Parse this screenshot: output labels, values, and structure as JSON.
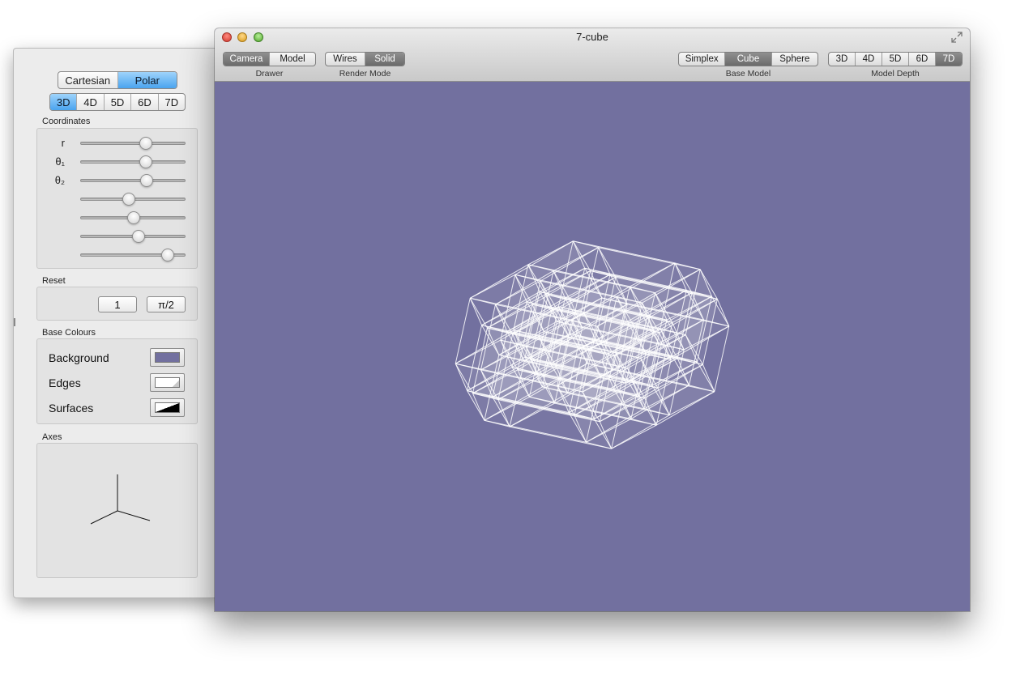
{
  "colors": {
    "background": "#72709f",
    "edges": "#ffffff",
    "surface_hint": "#000000",
    "selected_segment": "#4aa4ef"
  },
  "drawer": {
    "coordinate_mode": [
      {
        "label": "Cartesian",
        "selected": false
      },
      {
        "label": "Polar",
        "selected": true
      }
    ],
    "dimensions": [
      {
        "label": "3D",
        "selected": true
      },
      {
        "label": "4D",
        "selected": false
      },
      {
        "label": "5D",
        "selected": false
      },
      {
        "label": "6D",
        "selected": false
      },
      {
        "label": "7D",
        "selected": false
      }
    ],
    "coordinates_label": "Coordinates",
    "sliders": [
      {
        "label": "r",
        "value": 0.64
      },
      {
        "label": "θ₁",
        "value": 0.64
      },
      {
        "label": "θ₂",
        "value": 0.65
      },
      {
        "label": "",
        "value": 0.46
      },
      {
        "label": "",
        "value": 0.51
      },
      {
        "label": "",
        "value": 0.56
      },
      {
        "label": "",
        "value": 0.88
      }
    ],
    "reset_label": "Reset",
    "reset_buttons": [
      "1",
      "π/2"
    ],
    "base_colours_label": "Base Colours",
    "colour_rows": [
      {
        "label": "Background",
        "swatch": "#72709f"
      },
      {
        "label": "Edges",
        "swatch": "#ffffff"
      },
      {
        "label": "Surfaces",
        "swatch": "#000000"
      }
    ],
    "axes_label": "Axes"
  },
  "window": {
    "title": "7-cube",
    "toolbar": {
      "drawer": {
        "caption": "Drawer",
        "items": [
          {
            "label": "Camera",
            "selected": true
          },
          {
            "label": "Model",
            "selected": false
          }
        ]
      },
      "render_mode": {
        "caption": "Render Mode",
        "items": [
          {
            "label": "Wires",
            "selected": false
          },
          {
            "label": "Solid",
            "selected": true
          }
        ]
      },
      "base_model": {
        "caption": "Base Model",
        "items": [
          {
            "label": "Simplex",
            "selected": false
          },
          {
            "label": "Cube",
            "selected": true
          },
          {
            "label": "Sphere",
            "selected": false
          }
        ]
      },
      "model_depth": {
        "caption": "Model Depth",
        "items": [
          {
            "label": "3D",
            "selected": false
          },
          {
            "label": "4D",
            "selected": false
          },
          {
            "label": "5D",
            "selected": false
          },
          {
            "label": "6D",
            "selected": false
          },
          {
            "label": "7D",
            "selected": true
          }
        ]
      }
    }
  }
}
